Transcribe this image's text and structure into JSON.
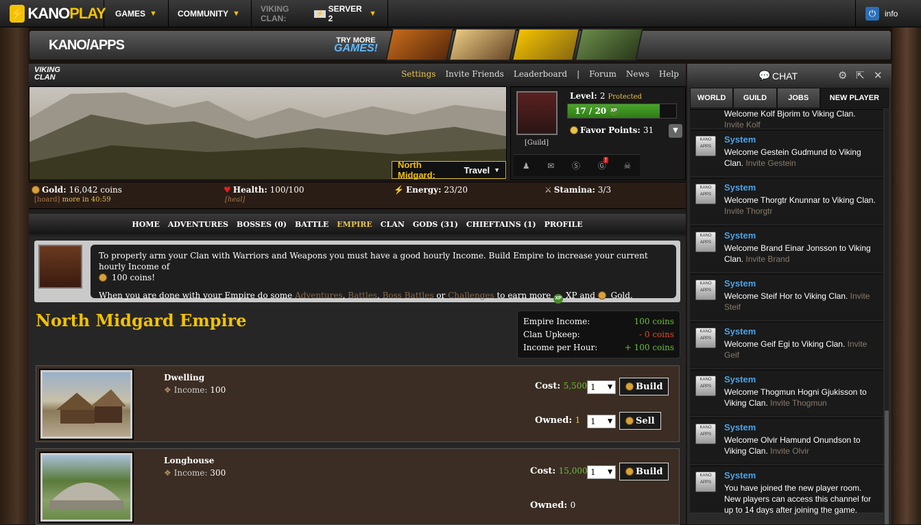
{
  "topbar": {
    "logo_kano": "KANO",
    "logo_play": "PLAY",
    "games": "GAMES",
    "community": "COMMUNITY",
    "viking_clan": "VIKING CLAN:",
    "server": "SERVER 2",
    "info": "info"
  },
  "appbar": {
    "kano_apps": "KANO/APPS",
    "try_more": "TRY MORE",
    "games": "GAMES!"
  },
  "game_nav": {
    "logo": "VIKING CLAN",
    "links": [
      "Settings",
      "Invite Friends",
      "Leaderboard",
      "|",
      "Forum",
      "News",
      "Help"
    ],
    "active": "Settings"
  },
  "travel": {
    "location": "North Midgard:",
    "action": "Travel"
  },
  "player": {
    "level_label": "Level:",
    "level": "2",
    "protected": "Protected",
    "xp_text": "17 / 20",
    "xp_fraction": 0.85,
    "favor_label": "Favor Points:",
    "favor": "31",
    "guild": "[Guild]",
    "notification_badge": "!"
  },
  "stats": {
    "gold_label": "Gold:",
    "gold": "16,042 coins",
    "hoard": "[hoard]",
    "more_in": "more in 40:59",
    "health_label": "Health:",
    "health": "100/100",
    "heal": "[heal]",
    "energy_label": "Energy:",
    "energy": "23/20",
    "stamina_label": "Stamina:",
    "stamina": "3/3"
  },
  "menu": {
    "items": [
      "HOME",
      "ADVENTURES",
      "BOSSES (0)",
      "BATTLE",
      "EMPIRE",
      "CLAN",
      "GODS (31)",
      "CHIEFTAINS (1)",
      "PROFILE"
    ],
    "active": "EMPIRE"
  },
  "tip": {
    "line1": "To properly arm your Clan with Warriors and Weapons you must have a good hourly Income. Build Empire to increase your current hourly Income of",
    "line1_amount": "100 coins!",
    "line2_start": "When you are done with your Empire do some",
    "adventures": "Adventures",
    "battles": "Battles",
    "boss_battles": "Boss Battles",
    "or": "or",
    "challenges": "Challenges",
    "earn_more": "to earn more",
    "xp_and": "XP and",
    "gold": "Gold."
  },
  "empire": {
    "title": "North Midgard Empire",
    "income_label": "Empire Income:",
    "income": "100 coins",
    "upkeep_label": "Clan Upkeep:",
    "upkeep": "- 0 coins",
    "per_hour_label": "Income per Hour:",
    "per_hour": "+ 100 coins"
  },
  "buildings": [
    {
      "name": "Dwelling",
      "income_label": "Income:",
      "income": "100",
      "cost_label": "Cost:",
      "cost": "5,500",
      "qty": "1",
      "build": "Build",
      "owned_label": "Owned:",
      "owned": "1",
      "sell_qty": "1",
      "sell": "Sell"
    },
    {
      "name": "Longhouse",
      "income_label": "Income:",
      "income": "300",
      "cost_label": "Cost:",
      "cost": "15,000",
      "qty": "1",
      "build": "Build",
      "owned_label": "Owned:",
      "owned": "0"
    }
  ],
  "chat": {
    "title": "CHAT",
    "tabs": [
      "WORLD",
      "GUILD",
      "JOBS",
      "NEW PLAYER"
    ],
    "active_tab": "NEW PLAYER",
    "top_partial": {
      "text": "Welcome Kolf Bjorim to Viking Clan.",
      "invite": "Invite Kolf"
    },
    "messages": [
      {
        "who": "System",
        "text": "Welcome Gestein Gudmund to Viking Clan.",
        "invite": "Invite Gestein"
      },
      {
        "who": "System",
        "text": "Welcome Thorgtr Knunnar to Viking Clan.",
        "invite": "Invite Thorgtr"
      },
      {
        "who": "System",
        "text": "Welcome Brand Einar Jonsson to Viking Clan.",
        "invite": "Invite Brand"
      },
      {
        "who": "System",
        "text": "Welcome Steif Hor to Viking Clan.",
        "invite": "Invite Steif"
      },
      {
        "who": "System",
        "text": "Welcome Geif Egi to Viking Clan.",
        "invite": "Invite Geif"
      },
      {
        "who": "System",
        "text": "Welcome Thogmun Hogni Gjukisson to Viking Clan.",
        "invite": "Invite Thogmun"
      },
      {
        "who": "System",
        "text": "Welcome Olvir Hamund Onundson to Viking Clan.",
        "invite": "Invite Olvir"
      },
      {
        "who": "System",
        "text": "You have joined the new player room. New players can access this channel for up to 14 days after joining the game.",
        "invite": ""
      }
    ]
  }
}
